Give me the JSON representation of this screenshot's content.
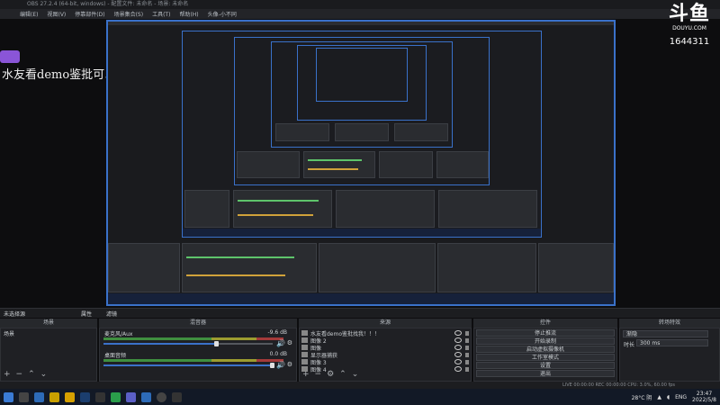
{
  "window": {
    "title": "OBS 27.2.4 (64-bit, windows) - 配置文件: 未命名 - 场景: 未命名"
  },
  "menu": [
    "编辑(E)",
    "视图(V)",
    "停靠部件(D)",
    "场景集合(S)",
    "工具(T)",
    "帮助(H)",
    "头像-小不同"
  ],
  "overlay": {
    "brand": "斗鱼",
    "brand_sub": "DOUYU.COM",
    "room_id": "1644311",
    "chat_message": "水友看demo鉴批可以找我！"
  },
  "scene_bar": {
    "left_label": "未选择源",
    "properties_label": "属性",
    "filters_label": "滤镜"
  },
  "docks": {
    "scenes": {
      "title": "场景",
      "items": [
        "场景"
      ]
    },
    "mixer": {
      "title": "混音器",
      "channels": [
        {
          "name": "麦克风/Aux",
          "db": "-9.6 dB",
          "volume": 0.72
        },
        {
          "name": "桌面音频",
          "db": "0.0 dB",
          "volume": 0.95
        }
      ]
    },
    "sources": {
      "title": "来源",
      "items": [
        "水友看demo鉴批找我！！！",
        "图像 2",
        "图像",
        "显示器捕获",
        "图像 3",
        "图像 4"
      ]
    },
    "controls": {
      "title": "控件",
      "buttons": [
        "停止推流",
        "开始录制",
        "启动虚拟摄像机",
        "工作室模式",
        "设置",
        "退出"
      ]
    },
    "transitions": {
      "title": "转场特效",
      "type": "渐隐",
      "duration_label": "时长",
      "duration": "300 ms"
    }
  },
  "status": {
    "text": "LIVE 00:00:00   REC 00:00:00   CPU: 3.0%, 60.00 fps"
  },
  "tray": {
    "weather": "28°C 阴",
    "lang": "ENG",
    "time": "23:47",
    "date": "2022/5/8"
  },
  "chart_data": []
}
